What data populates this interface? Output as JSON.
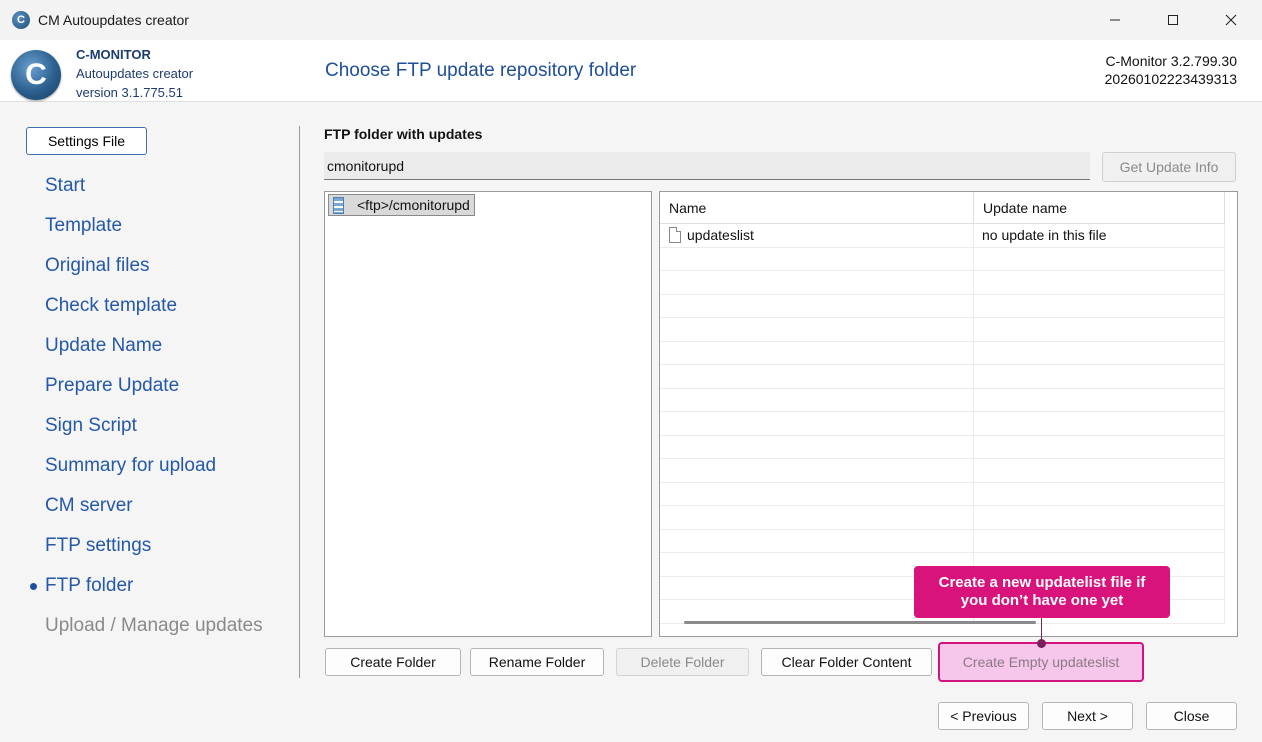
{
  "window": {
    "title": "CM Autoupdates creator",
    "icon": "cmonitor-app-icon"
  },
  "header": {
    "logo_letter": "C",
    "brand_name": "C-MONITOR",
    "brand_product": "Autoupdates creator",
    "brand_version": "version 3.1.775.51",
    "page_title": "Choose FTP update repository folder",
    "cm_version": "C-Monitor 3.2.799.30",
    "build_id": "20260102223439313"
  },
  "sidebar": {
    "settings_button": "Settings File",
    "items": [
      {
        "label": "Start",
        "state": "normal"
      },
      {
        "label": "Template",
        "state": "normal"
      },
      {
        "label": "Original files",
        "state": "normal"
      },
      {
        "label": "Check template",
        "state": "normal"
      },
      {
        "label": "Update Name",
        "state": "normal"
      },
      {
        "label": "Prepare Update",
        "state": "normal"
      },
      {
        "label": "Sign Script",
        "state": "normal"
      },
      {
        "label": "Summary for upload",
        "state": "normal"
      },
      {
        "label": "CM server",
        "state": "normal"
      },
      {
        "label": "FTP settings",
        "state": "normal"
      },
      {
        "label": "FTP folder",
        "state": "active"
      },
      {
        "label": "Upload / Manage updates",
        "state": "disabled"
      }
    ]
  },
  "main": {
    "ftp_folder_label": "FTP folder with updates",
    "ftp_folder_value": "cmonitorupd",
    "get_update_info_label": "Get Update Info",
    "tree": {
      "root_label": "<ftp>/cmonitorupd"
    },
    "table": {
      "columns": [
        "Name",
        "Update name"
      ],
      "rows": [
        {
          "name": "updateslist",
          "update_name": "no update in this file"
        }
      ]
    },
    "buttons": {
      "create_folder": "Create Folder",
      "rename_folder": "Rename Folder",
      "delete_folder": "Delete Folder",
      "clear_folder_content": "Clear Folder Content",
      "create_empty_updateslist": "Create Empty updateslist"
    }
  },
  "footer": {
    "previous": "< Previous",
    "next": "Next >",
    "close": "Close"
  },
  "callout": {
    "line1": "Create a new updatelist file if",
    "line2": "you don’t have one yet",
    "color": "#d9137c"
  },
  "colors": {
    "accent": "#2458a8",
    "highlight_border": "#d0137e",
    "highlight_fill": "#f6c7ea"
  }
}
